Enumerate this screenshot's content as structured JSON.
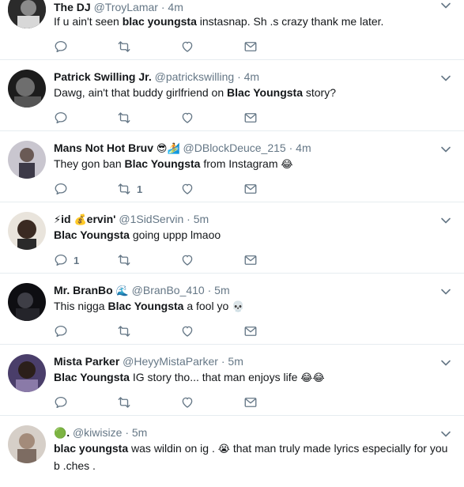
{
  "tweets": [
    {
      "name": "The DJ",
      "handle": "@TroyLamar",
      "time": "4m",
      "parts": [
        {
          "t": "If u ain't seen ",
          "b": false
        },
        {
          "t": "blac youngsta",
          "b": true
        },
        {
          "t": " instasnap. Sh  .s crazy thank me later.",
          "b": false
        }
      ],
      "reply_count": "",
      "retweet_count": ""
    },
    {
      "name": "Patrick Swilling Jr.",
      "handle": "@patrickswilling",
      "time": "4m",
      "parts": [
        {
          "t": "Dawg, ain't that buddy girlfriend on ",
          "b": false
        },
        {
          "t": "Blac Youngsta",
          "b": true
        },
        {
          "t": " story?",
          "b": false
        }
      ],
      "reply_count": "",
      "retweet_count": ""
    },
    {
      "name": "Mans Not Hot Bruv",
      "name_emoji": "😎🏄",
      "handle": "@DBlockDeuce_215",
      "time": "4m",
      "parts": [
        {
          "t": "They gon ban ",
          "b": false
        },
        {
          "t": "Blac Youngsta",
          "b": true
        },
        {
          "t": " from Instagram ",
          "b": false
        },
        {
          "t": "😂",
          "b": false
        }
      ],
      "reply_count": "",
      "retweet_count": "1"
    },
    {
      "name_prefix": "⚡",
      "name": "id",
      "name_mid": "💰",
      "name_suffix": "ervin'",
      "handle": "@1SidServin",
      "time": "5m",
      "parts": [
        {
          "t": "Blac Youngsta",
          "b": true
        },
        {
          "t": " going uppp lmaoo",
          "b": false
        }
      ],
      "reply_count": "1",
      "retweet_count": ""
    },
    {
      "name": "Mr. BranBo",
      "name_emoji": "🌊",
      "handle": "@BranBo_410",
      "time": "5m",
      "parts": [
        {
          "t": "This nigga ",
          "b": false
        },
        {
          "t": "Blac Youngsta",
          "b": true
        },
        {
          "t": " a fool yo ",
          "b": false
        },
        {
          "t": "💀",
          "b": false
        }
      ],
      "reply_count": "",
      "retweet_count": ""
    },
    {
      "name": "Mista Parker",
      "handle": "@HeyyMistaParker",
      "time": "5m",
      "parts": [
        {
          "t": "Blac Youngsta",
          "b": true
        },
        {
          "t": " IG story tho... that man enjoys life ",
          "b": false
        },
        {
          "t": "😂😂",
          "b": false
        }
      ],
      "reply_count": "",
      "retweet_count": ""
    },
    {
      "name_prefix": "🟢",
      "name": ".",
      "handle": "@kiwisize",
      "time": "5m",
      "parts": [
        {
          "t": "blac youngsta",
          "b": true
        },
        {
          "t": " was wildin on ig . ",
          "b": false
        },
        {
          "t": "😭",
          "b": false
        },
        {
          "t": " that man truly made lyrics especially for you b  .ches .",
          "b": false
        }
      ],
      "reply_count": "",
      "retweet_count": ""
    }
  ],
  "icons": {
    "reply": "reply-icon",
    "retweet": "retweet-icon",
    "like": "heart-icon",
    "dm": "envelope-icon",
    "caret": "chevron-down-icon"
  },
  "colors": {
    "icon_gray": "#657786",
    "divider": "#e6ecf0",
    "name_text": "#14171a"
  }
}
